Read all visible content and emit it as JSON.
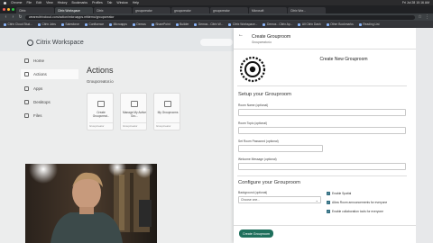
{
  "menubar": {
    "app": "Chrome",
    "items": [
      "File",
      "Edit",
      "View",
      "History",
      "Bookmarks",
      "Profiles",
      "Tab",
      "Window",
      "Help"
    ],
    "clock": "Fri Jul 28 10:16 AM"
  },
  "browser": {
    "tabs": [
      {
        "label": "Citrix",
        "active": false
      },
      {
        "label": "Citrix Workspace",
        "active": true
      },
      {
        "label": "Citrix",
        "active": false
      },
      {
        "label": "groupcreator",
        "active": false
      },
      {
        "label": "groupcreator",
        "active": false
      },
      {
        "label": "groupcreator",
        "active": false
      },
      {
        "label": "Microsoft",
        "active": false
      },
      {
        "label": "Citrix Wor...",
        "active": false
      }
    ],
    "url": "wearecitrixcloud.com/action/microapps.mfdemo/groupcreator"
  },
  "bookmarks": [
    "Citrix Cloud Stud...",
    "Citrix Jobs",
    "Salesforce",
    "Confluence",
    "Microapps",
    "Demos",
    "SharePoint",
    "Builder",
    "Demos - Citrix W...",
    "Citrix Workspace...",
    "Demos - Citrix Ap...",
    "All Citrix Dash",
    "Other Bookmarks",
    "Reading List"
  ],
  "workspace": {
    "brand": "Citrix Workspace",
    "sidebar": [
      "Home",
      "Actions",
      "Apps",
      "Desktops",
      "Files"
    ],
    "active_sidebar": "Actions",
    "title": "Actions",
    "section": "Groupcreator.io",
    "cards": [
      {
        "label": "Create Groupcreat...",
        "source": "Groupcreator"
      },
      {
        "label": "Manage My Active Gro...",
        "source": "Groupcreator"
      },
      {
        "label": "My Grouprooms",
        "source": "Groupcreator"
      }
    ]
  },
  "panel": {
    "title": "Create Grouproom",
    "subtitle": "Groupcreator.io",
    "app_name": "Create New Grouproom",
    "setup_heading": "Setup your Grouproom",
    "fields": [
      {
        "label": "Room Name (optional)",
        "value": ""
      },
      {
        "label": "Room Topic (optional)",
        "value": ""
      },
      {
        "label": "Set Room Password (optional)",
        "value": ""
      },
      {
        "label": "Welcome Message (optional)",
        "value": ""
      }
    ],
    "configure_heading": "Configure your Grouproom",
    "bg_label": "Background (optional)",
    "bg_value": "Choose one...",
    "checkboxes": [
      {
        "label": "Enable Spatial",
        "checked": true
      },
      {
        "label": "Allow Room announcements for everyone",
        "checked": true
      },
      {
        "label": "Enable collaboration tools for everyone",
        "checked": true
      }
    ],
    "submit": "Create Grouproom"
  },
  "colors": {
    "accent": "#1f6f5c",
    "checkbox": "#2d6b7f",
    "page_bg": "#eceded"
  }
}
